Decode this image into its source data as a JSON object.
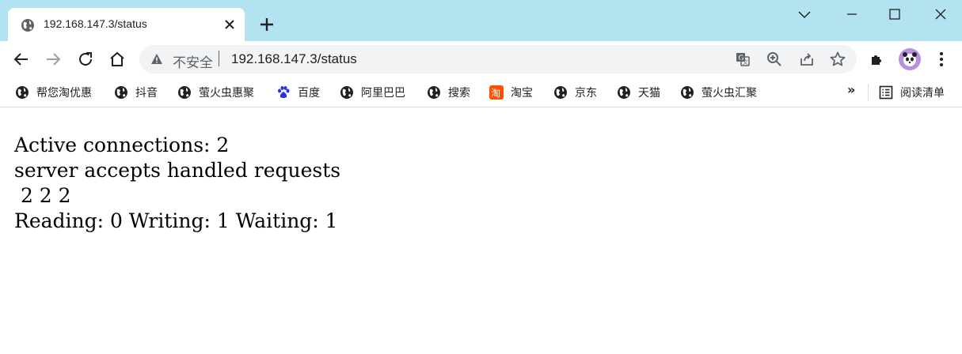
{
  "tab": {
    "title": "192.168.147.3/status",
    "favicon": "globe-icon"
  },
  "toolbar": {
    "security_label": "不安全",
    "url": "192.168.147.3/status"
  },
  "bookmarks": [
    {
      "label": "帮您淘优惠",
      "icon": "globe-icon"
    },
    {
      "label": "抖音",
      "icon": "globe-icon"
    },
    {
      "label": "萤火虫惠聚",
      "icon": "globe-icon"
    },
    {
      "label": "百度",
      "icon": "baidu-paw-icon"
    },
    {
      "label": "阿里巴巴",
      "icon": "globe-icon"
    },
    {
      "label": "搜索",
      "icon": "globe-icon"
    },
    {
      "label": "淘宝",
      "icon": "taobao-icon"
    },
    {
      "label": "京东",
      "icon": "globe-icon"
    },
    {
      "label": "天猫",
      "icon": "globe-icon"
    },
    {
      "label": "萤火虫汇聚",
      "icon": "globe-icon"
    }
  ],
  "bookmarks_more": "»",
  "reading_list": "阅读清单",
  "status": {
    "line1": "Active connections: 2",
    "line2": "server accepts handled requests",
    "line3": " 2 2 2",
    "line4": "Reading: 0 Writing: 1 Waiting: 1"
  },
  "colors": {
    "tabstrip": "#b3e3f0",
    "omnibox": "#f1f3f4",
    "avatar": "#b98fe0"
  }
}
